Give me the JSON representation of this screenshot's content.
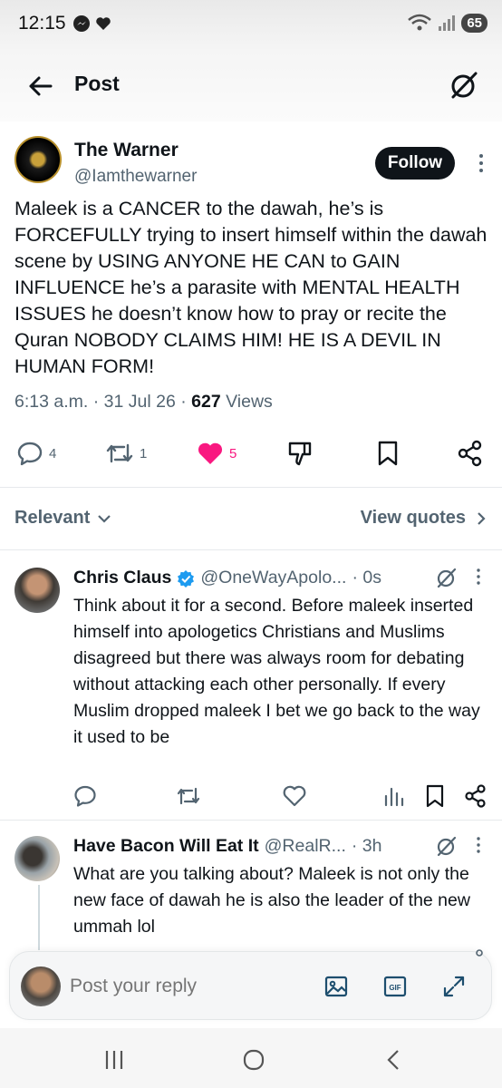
{
  "status_bar": {
    "time": "12:15",
    "battery": "65"
  },
  "header": {
    "title": "Post"
  },
  "post": {
    "author_name": "The Warner",
    "author_handle": "@Iamthewarner",
    "follow_label": "Follow",
    "text": "Maleek is a CANCER to the dawah, he’s is FORCEFULLY trying to insert himself within the dawah scene by USING ANYONE HE CAN to GAIN INFLUENCE he’s a parasite with MENTAL HEALTH ISSUES he doesn’t know how to pray or recite the Quran NOBODY CLAIMS HIM! HE IS A DEVIL IN HUMAN FORM!",
    "time": "6:13 a.m.",
    "date": "31 Jul 26",
    "views_count": "627",
    "views_label": "Views",
    "replies": "4",
    "reposts": "1",
    "likes": "5"
  },
  "filter": {
    "relevant_label": "Relevant",
    "view_quotes_label": "View quotes"
  },
  "replies": [
    {
      "name": "Chris Claus",
      "handle": "@OneWayApolo...",
      "time": "· 0s",
      "verified": true,
      "text": "Think about it for a second. Before maleek inserted himself into apologetics Christians and Muslims disagreed but there was always room for debating without attacking each other personally. If every Muslim dropped maleek I bet we go back to the way it used to be"
    },
    {
      "name": "Have Bacon Will Eat It",
      "handle": "@RealR...",
      "time": "· 3h",
      "text": "What are you talking about? Maleek is not only the new face of dawah he is also the leader of the new ummah lol"
    }
  ],
  "composer": {
    "placeholder": "Post your reply"
  },
  "colors": {
    "like": "#f91880",
    "text": "#0f1419",
    "muted": "#536471",
    "verified": "#1d9bf0"
  }
}
